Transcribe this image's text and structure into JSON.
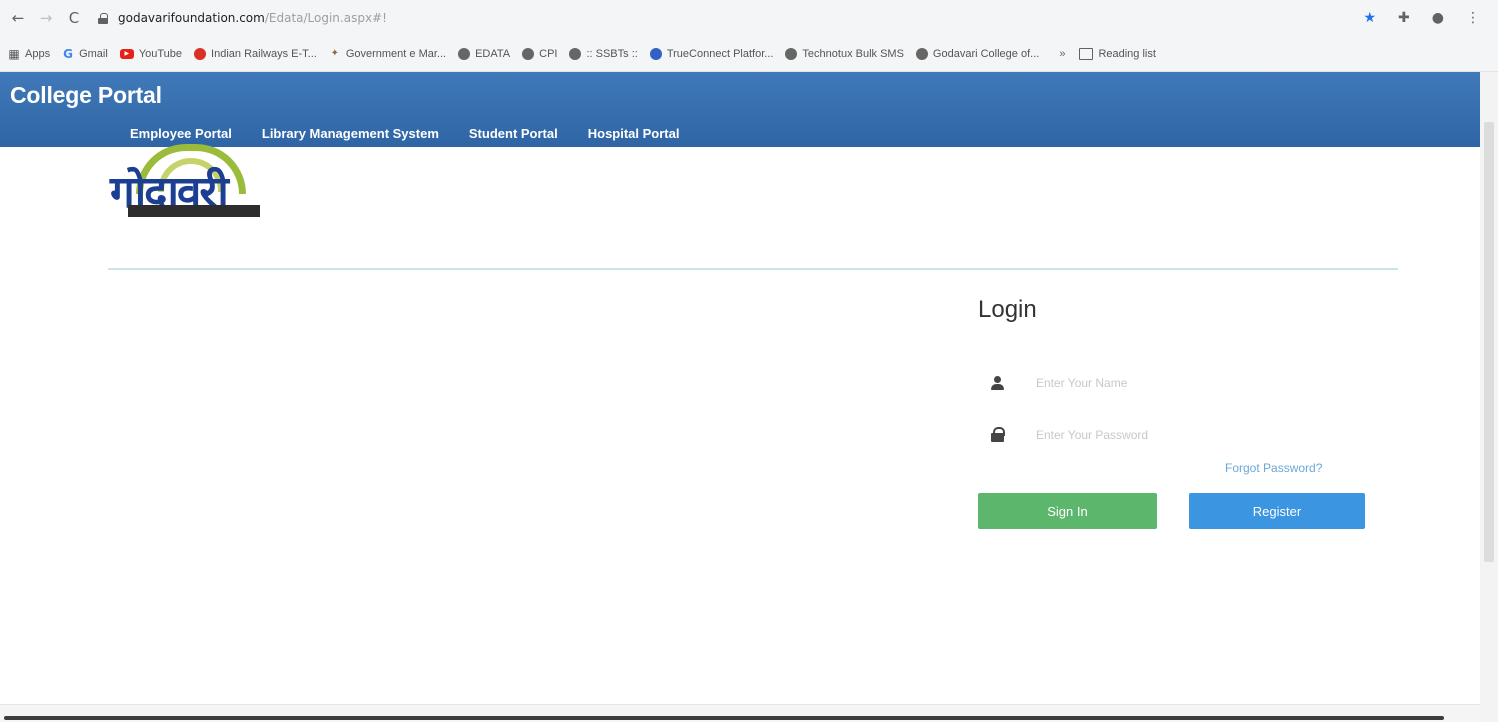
{
  "browser": {
    "url_domain": "godavarifoundation.com",
    "url_path": "/Edata/Login.aspx#!",
    "bookmarks": [
      {
        "label": "Apps",
        "icon": "apps-grid-icon"
      },
      {
        "label": "Gmail",
        "icon": "google-icon"
      },
      {
        "label": "YouTube",
        "icon": "youtube-icon"
      },
      {
        "label": "Indian Railways E-T...",
        "icon": "railways-icon"
      },
      {
        "label": "Government e Mar...",
        "icon": "gem-icon"
      },
      {
        "label": "EDATA",
        "icon": "globe-icon"
      },
      {
        "label": "CPI",
        "icon": "globe-icon"
      },
      {
        "label": ":: SSBTs ::",
        "icon": "globe-icon"
      },
      {
        "label": "TrueConnect Platfor...",
        "icon": "trueconnect-icon"
      },
      {
        "label": "Technotux Bulk SMS",
        "icon": "globe-icon"
      },
      {
        "label": "Godavari College of...",
        "icon": "globe-icon"
      }
    ],
    "more_label": "»",
    "reading_list": "Reading list"
  },
  "header": {
    "brand": "College Portal",
    "nav": [
      "Employee Portal",
      "Library Management System",
      "Student Portal",
      "Hospital Portal"
    ]
  },
  "logo": {
    "main_text": "गोदावरी"
  },
  "login": {
    "title": "Login",
    "username_placeholder": "Enter Your Name",
    "password_placeholder": "Enter Your Password",
    "forgot": "Forgot Password?",
    "sign_in": "Sign In",
    "register": "Register"
  },
  "colors": {
    "header_blue": "#3a6fae",
    "sign_in_green": "#5cb66b",
    "register_blue": "#3b95e0",
    "link_blue": "#6aa8d8"
  }
}
